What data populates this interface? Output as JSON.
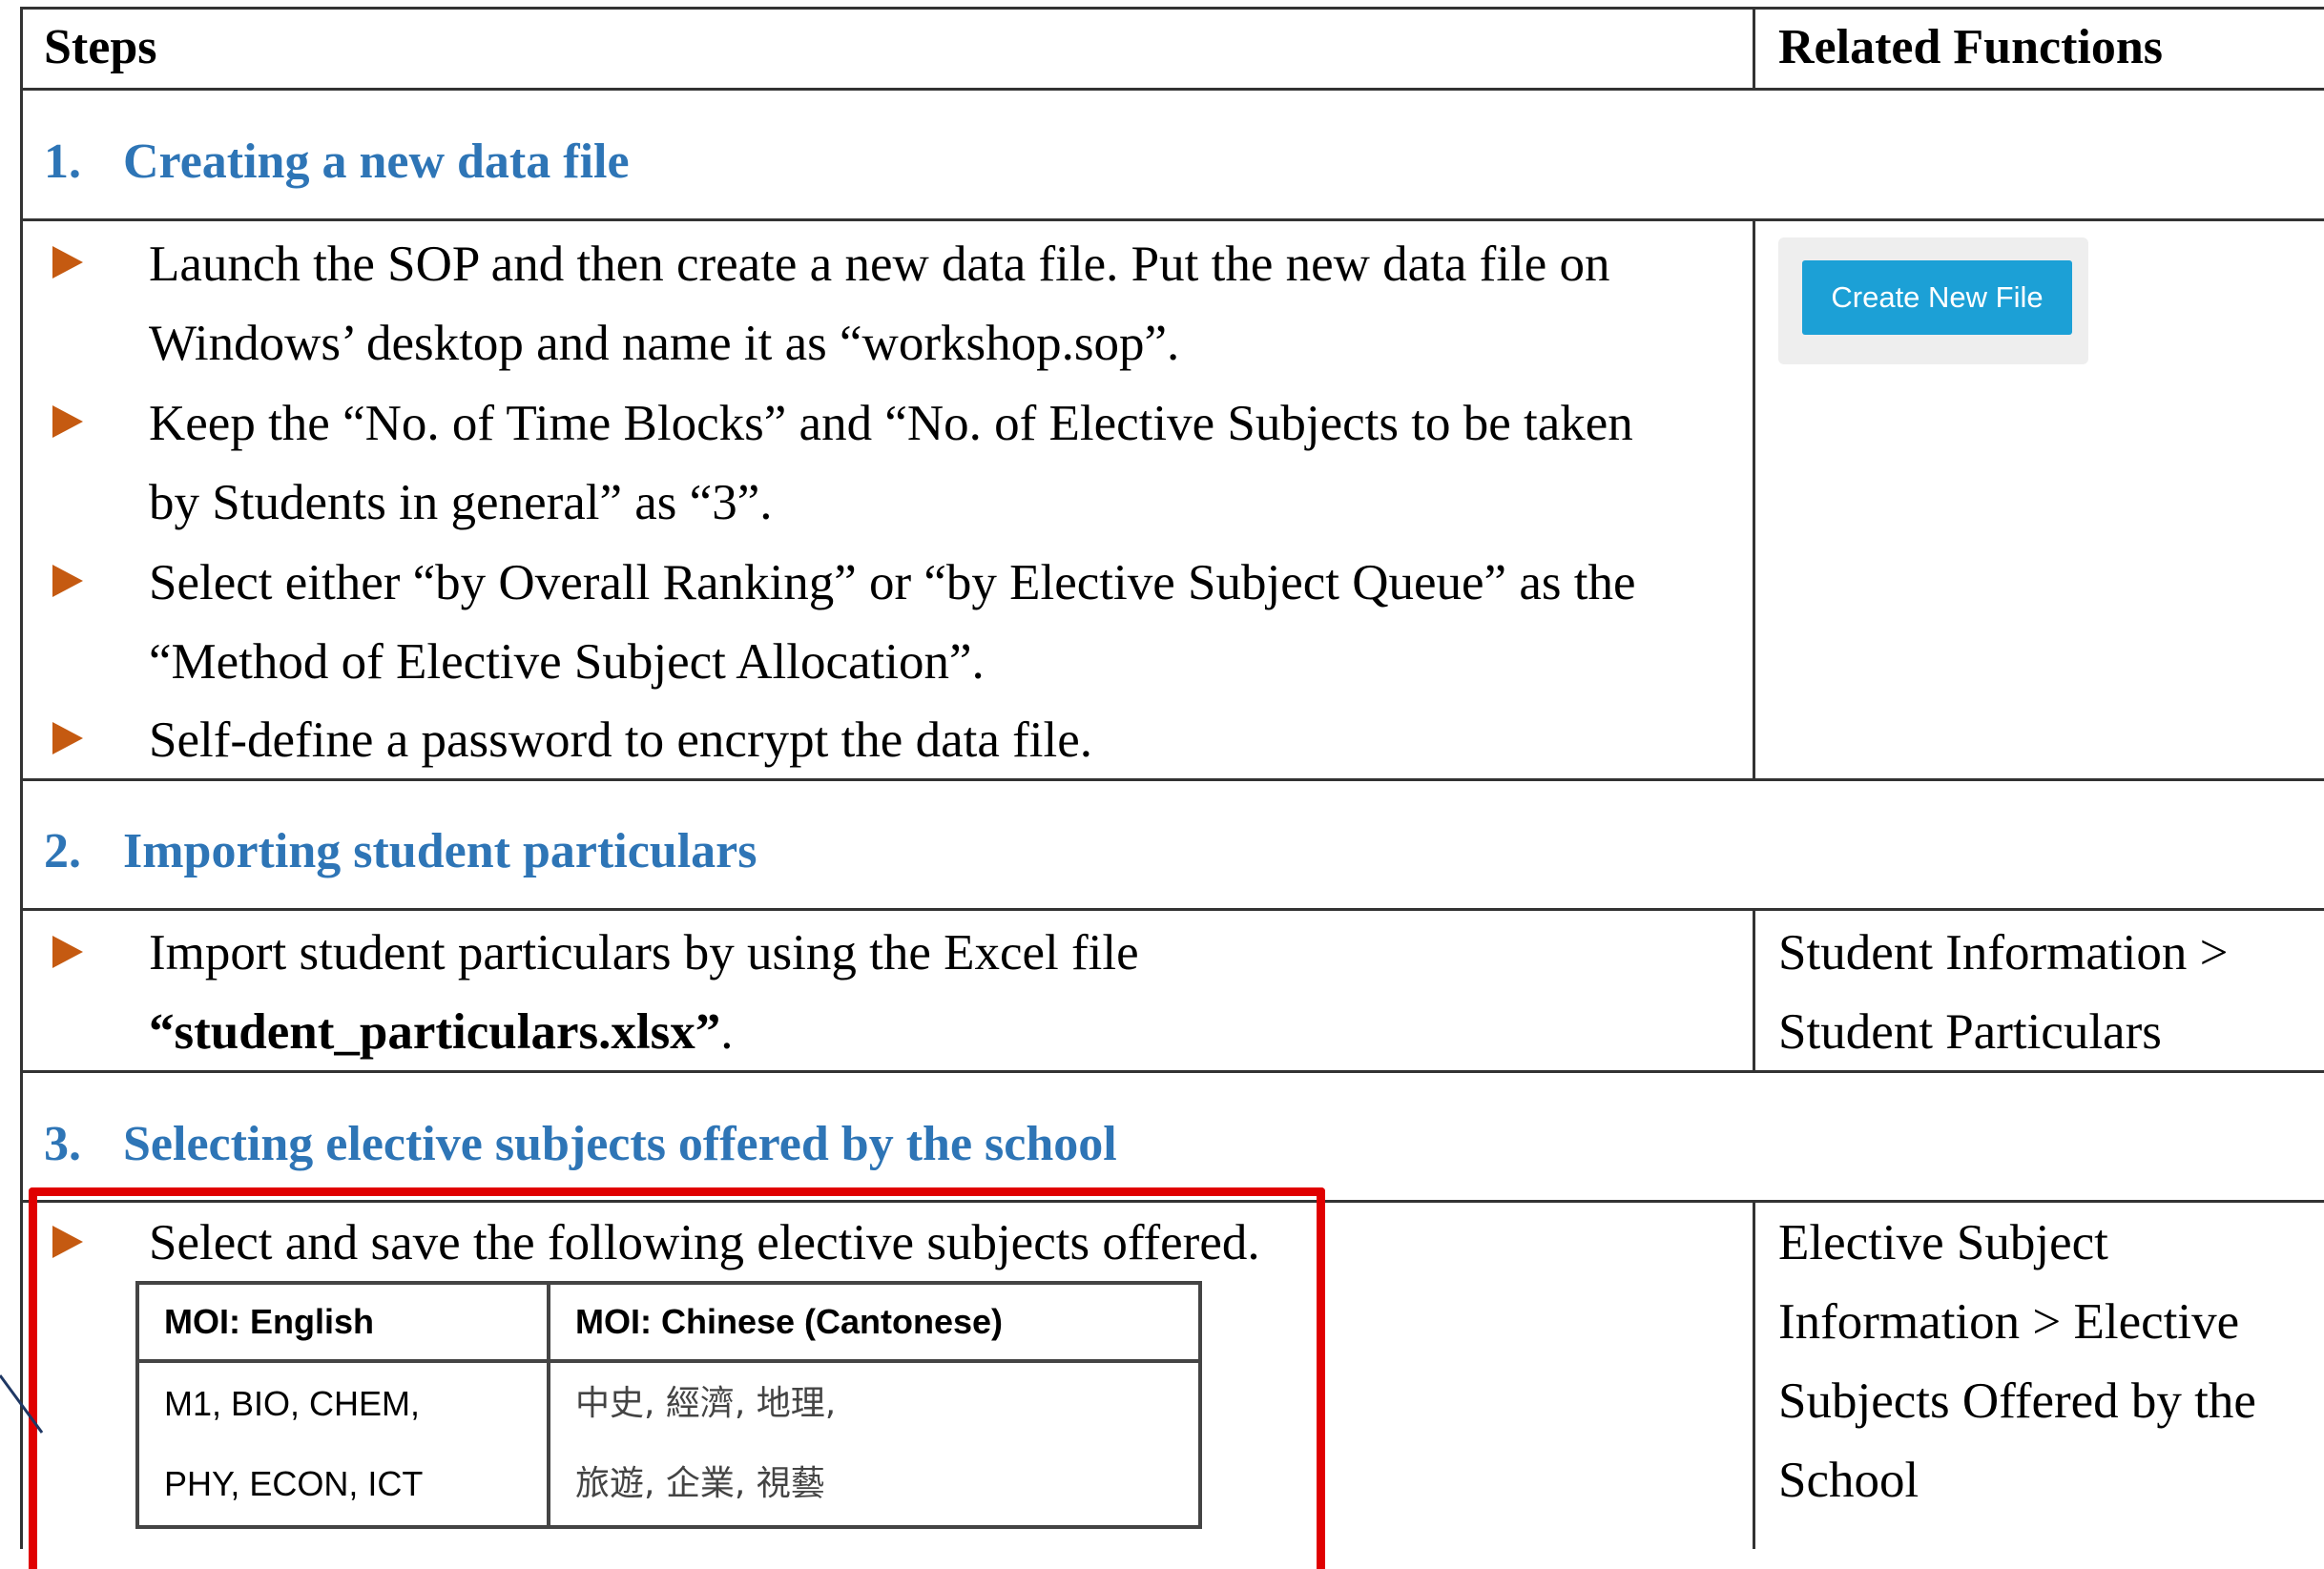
{
  "table": {
    "header": {
      "steps": "Steps",
      "related_functions": "Related Functions"
    },
    "sections": [
      {
        "number": "1.",
        "title": "Creating a new data file",
        "bullets": [
          {
            "line1": "Launch the SOP and then create a new data file. Put the new data file on",
            "line2": "Windows’ desktop and name it as “workshop.sop”."
          },
          {
            "line1": "Keep the “No. of Time Blocks” and “No. of Elective Subjects to be taken",
            "line2": "by Students in general” as “3”."
          },
          {
            "line1": "Select either “by Overall Ranking” or “by Elective Subject Queue” as the",
            "line2": "“Method of Elective Subject Allocation”."
          },
          {
            "line1": "Self-define a password to encrypt the data file."
          }
        ],
        "related": {
          "button_label": "Create New File"
        }
      },
      {
        "number": "2.",
        "title": "Importing student particulars",
        "bullets": [
          {
            "line1": "Import student particulars by using the Excel file",
            "line2_bold": "“student_particulars.xlsx”",
            "line2_tail": "."
          }
        ],
        "related": {
          "line1": "Student Information >",
          "line2": "Student Particulars"
        }
      },
      {
        "number": "3.",
        "title": "Selecting elective subjects offered by the school",
        "bullets": [
          {
            "line1": "Select and save the following elective subjects offered."
          }
        ],
        "subjects_table": {
          "headers": [
            "MOI: English",
            "MOI: Chinese (Cantonese)"
          ],
          "english": [
            "M1, BIO, CHEM,",
            "PHY, ECON, ICT"
          ],
          "chinese": [
            "中史,  經濟,  地理,",
            "旅遊,  企業,  視藝"
          ]
        },
        "related": {
          "line1": "Elective Subject",
          "line2": "Information > Elective",
          "line3": "Subjects Offered by the",
          "line4": "School"
        }
      }
    ]
  },
  "colors": {
    "section_title": "#2e75b6",
    "bullet": "#c55a11",
    "button": "#1ca0d6",
    "highlight_box": "#e00000"
  }
}
